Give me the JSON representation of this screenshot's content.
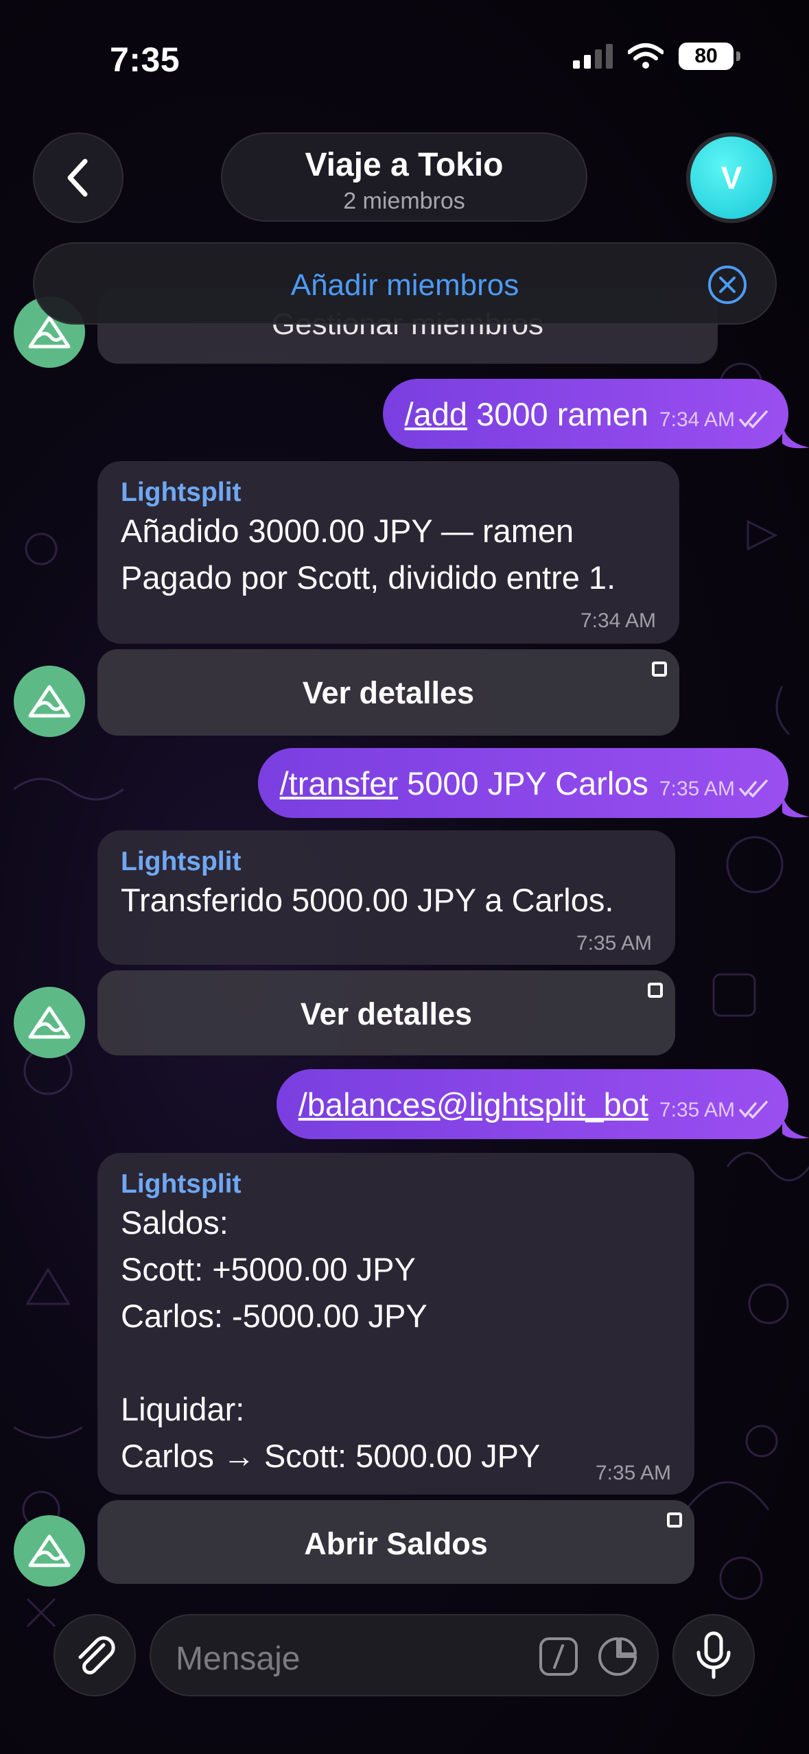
{
  "status_bar": {
    "time": "7:35",
    "battery": "80"
  },
  "header": {
    "title": "Viaje a Tokio",
    "subtitle": "2 miembros",
    "avatar_letter": "V"
  },
  "add_members": {
    "label": "Añadir miembros"
  },
  "hidden_bubble": {
    "label": "Gestionar miembros"
  },
  "messages": [
    {
      "type": "outgoing",
      "command": "/add",
      "text": " 3000 ramen",
      "time": "7:34 AM"
    },
    {
      "type": "incoming",
      "sender": "Lightsplit",
      "lines": [
        "Añadido 3000.00 JPY — ramen",
        "Pagado por Scott, dividido entre 1."
      ],
      "time": "7:34 AM",
      "button": "Ver detalles"
    },
    {
      "type": "outgoing",
      "command": "/transfer",
      "text": " 5000 JPY Carlos",
      "time": "7:35 AM"
    },
    {
      "type": "incoming",
      "sender": "Lightsplit",
      "lines": [
        "Transferido 5000.00 JPY a Carlos."
      ],
      "time": "7:35 AM",
      "button": "Ver detalles"
    },
    {
      "type": "outgoing",
      "command": "/balances@lightsplit_bot",
      "text": "",
      "time": "7:35 AM"
    },
    {
      "type": "incoming",
      "sender": "Lightsplit",
      "lines": [
        "Saldos:",
        "Scott: +5000.00 JPY",
        "Carlos: -5000.00 JPY",
        "",
        "Liquidar:",
        "Carlos → Scott: 5000.00 JPY"
      ],
      "time": "7:35 AM",
      "button": "Abrir Saldos"
    }
  ],
  "composer": {
    "placeholder": "Mensaje"
  },
  "colors": {
    "accent_purple": "#8a45ea",
    "link_blue": "#4d9bf7",
    "sender_blue": "#6fa8f5",
    "bot_green": "#5dba86",
    "avatar_cyan": "#1fd3de"
  },
  "icons": {
    "back": "chevron-left-icon",
    "close": "close-circle-icon",
    "attach": "paperclip-icon",
    "command": "slash-command-icon",
    "sticker": "sticker-icon",
    "mic": "microphone-icon",
    "read": "double-check-icon",
    "inline_button": "square-icon",
    "bot_avatar": "mountain-logo-icon"
  }
}
